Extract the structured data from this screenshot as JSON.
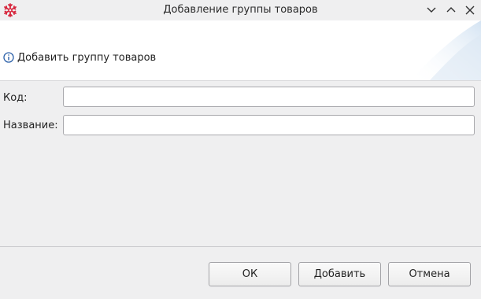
{
  "window": {
    "title": "Добавление группы товаров",
    "icons": [
      "app-snowflake-icon",
      "minimize-icon",
      "maximize-icon",
      "close-icon"
    ],
    "accent_color": "#d7263d"
  },
  "header": {
    "message": "Добавить группу товаров",
    "icon": "info-icon",
    "icon_color": "#2a5fa8"
  },
  "form": {
    "code_label": "Код:",
    "code_value": "",
    "name_label": "Название:",
    "name_value": ""
  },
  "buttons": {
    "ok": "ОК",
    "add": "Добавить",
    "cancel": "Отмена"
  }
}
